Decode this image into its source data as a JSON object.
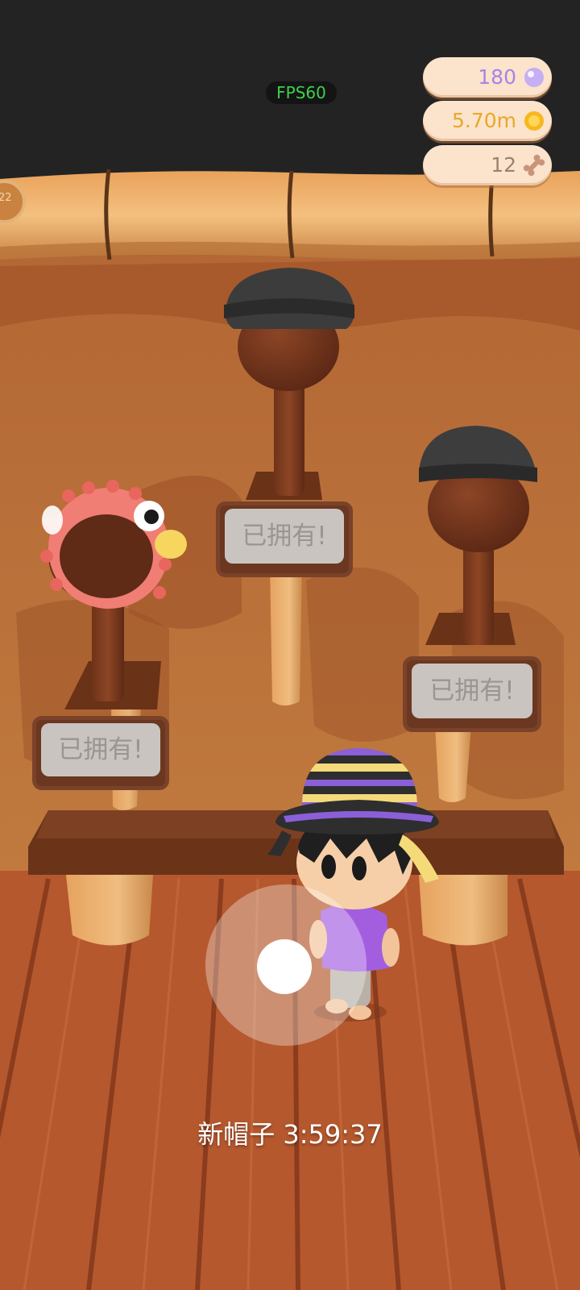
{
  "hud": {
    "fps": "FPS60",
    "currencies": [
      {
        "name": "pearls",
        "value": "180",
        "color": "#a784e6",
        "icon": "pearl-icon"
      },
      {
        "name": "coins",
        "value": "5.70m",
        "color": "#e8a92a",
        "icon": "coin-icon"
      },
      {
        "name": "bones",
        "value": "12",
        "color": "#9a8272",
        "icon": "bone-icon"
      }
    ]
  },
  "side_badge": "22",
  "stands": [
    {
      "name": "pufferfish-hat",
      "label": "已拥有!"
    },
    {
      "name": "flat-cap",
      "label": "已拥有!"
    },
    {
      "name": "beanie",
      "label": "已拥有!"
    }
  ],
  "player": {
    "hat": "striped-bucket-hat",
    "hat_colors": [
      "#8b5fd8",
      "#2e2e2e",
      "#f5da7a"
    ],
    "shirt_color": "#a35ee0"
  },
  "joystick": {
    "knob": "joystick-knob"
  },
  "timer_label": "新帽子 3:59:37"
}
